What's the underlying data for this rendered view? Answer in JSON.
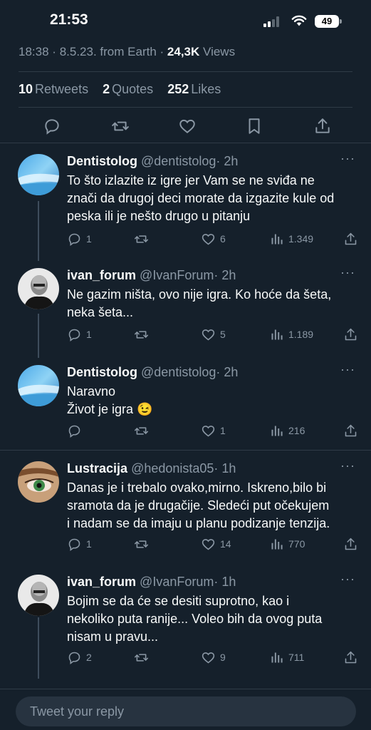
{
  "status_bar": {
    "time": "21:53",
    "battery": "49"
  },
  "tweet_meta": {
    "time": "18:38",
    "date": "8.5.23.",
    "source": "from Earth",
    "views_count": "24,3K",
    "views_label": "Views"
  },
  "engagement": {
    "retweets_count": "10",
    "retweets_label": "Retweets",
    "quotes_count": "2",
    "quotes_label": "Quotes",
    "likes_count": "252",
    "likes_label": "Likes"
  },
  "replies": [
    {
      "name": "Dentistolog",
      "handle": "@dentistolog",
      "time": "· 2h",
      "lines": [
        "To što izlazite iz igre jer Vam se ne sviđa ne",
        "znači da drugoj deci morate da izgazite kule od",
        "peska ili je nešto drugo u pitanju"
      ],
      "replies": "1",
      "retweets": "",
      "likes": "6",
      "views": "1.349"
    },
    {
      "name": "ivan_forum",
      "handle": "@IvanForum",
      "time": "· 2h",
      "lines": [
        "Ne gazim ništa, ovo nije igra. Ko hoće da šeta,",
        "neka šeta..."
      ],
      "replies": "1",
      "retweets": "",
      "likes": "5",
      "views": "1.189"
    },
    {
      "name": "Dentistolog",
      "handle": "@dentistolog",
      "time": "· 2h",
      "lines": [
        "Naravno",
        "Život je igra 😉"
      ],
      "replies": "",
      "retweets": "",
      "likes": "1",
      "views": "216"
    },
    {
      "name": "Lustracija",
      "handle": "@hedonista05",
      "time": "· 1h",
      "lines": [
        "Danas je i trebalo ovako,mirno. Iskreno,bilo bi",
        "sramota da je drugačije. Sledeći put očekujem",
        "i nadam se da imaju u planu podizanje tenzija."
      ],
      "replies": "1",
      "retweets": "",
      "likes": "14",
      "views": "770"
    },
    {
      "name": "ivan_forum",
      "handle": "@IvanForum",
      "time": "· 1h",
      "lines": [
        "Bojim se da će se desiti suprotno, kao i",
        "nekoliko puta ranije... Voleo bih da ovog puta",
        "nisam u pravu..."
      ],
      "replies": "2",
      "retweets": "",
      "likes": "9",
      "views": "711"
    }
  ],
  "more_label": "···",
  "reply_box": {
    "placeholder": "Tweet your reply"
  },
  "colors": {
    "background": "#15202b",
    "text": "#f7f9f9",
    "muted": "#8b98a5",
    "divider": "#2f3b47",
    "reply_box": "#273340"
  }
}
